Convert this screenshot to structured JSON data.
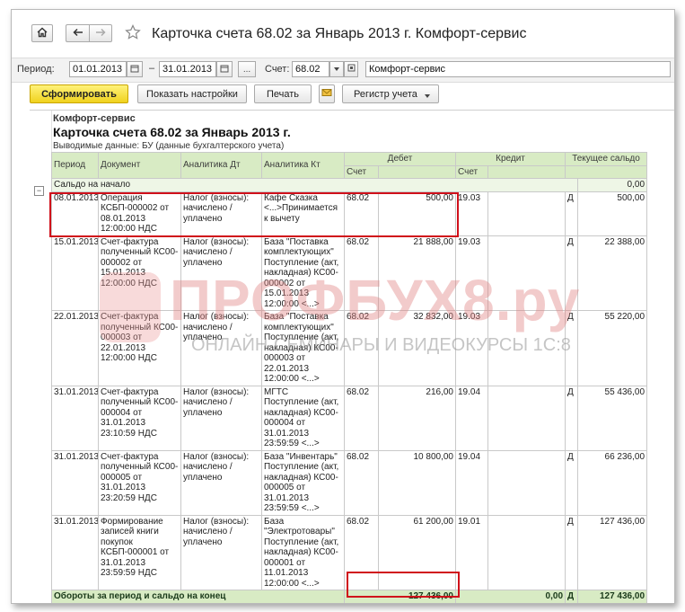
{
  "window": {
    "title": "Карточка счета 68.02 за Январь 2013 г. Комфорт-сервис",
    "home_icon": "home-icon",
    "back_icon": "arrow-left-icon",
    "forward_icon": "arrow-right-icon",
    "favorite_icon": "star-icon"
  },
  "filters": {
    "period_label": "Период:",
    "date_from": "01.01.2013",
    "dash": "–",
    "date_to": "31.01.2013",
    "more_label": "...",
    "account_label": "Счет:",
    "account_value": "68.02",
    "org_value": "Комфорт-сервис"
  },
  "toolbar": {
    "generate": "Сформировать",
    "settings": "Показать настройки",
    "print": "Печать",
    "register": "Регистр учета"
  },
  "report": {
    "org": "Комфорт-сервис",
    "title": "Карточка счета 68.02 за Январь 2013 г.",
    "subtitle": "Выводимые данные:  БУ (данные бухгалтерского учета)",
    "columns": {
      "period": "Период",
      "document": "Документ",
      "analytics_dt": "Аналитика Дт",
      "analytics_kt": "Аналитика Кт",
      "debit": "Дебет",
      "credit": "Кредит",
      "balance": "Текущее сальдо",
      "account": "Счет"
    },
    "opening": {
      "label": "Сальдо на начало",
      "value": "0,00"
    },
    "rows": [
      {
        "period": "08.01.2013",
        "document": "Операция КСБП-000002 от 08.01.2013 12:00:00 НДС",
        "dt": "Налог (взносы): начислено / уплачено",
        "kt": "Кафе Сказка <...>Принимается к вычету",
        "debit_acc": "68.02",
        "debit": "500,00",
        "credit_acc": "19.03",
        "credit": "",
        "sign": "Д",
        "balance": "500,00"
      },
      {
        "period": "15.01.2013",
        "document": "Счет-фактура полученный КС00-000002 от 15.01.2013 12:00:00 НДС",
        "dt": "Налог (взносы): начислено / уплачено",
        "kt": "База \"Поставка комплектующих\" Поступление (акт, накладная) КС00-000002 от 15.01.2013 12:00:00 <...>",
        "debit_acc": "68.02",
        "debit": "21 888,00",
        "credit_acc": "19.03",
        "credit": "",
        "sign": "Д",
        "balance": "22 388,00"
      },
      {
        "period": "22.01.2013",
        "document": "Счет-фактура полученный КС00-000003 от 22.01.2013 12:00:00 НДС",
        "dt": "Налог (взносы): начислено / уплачено",
        "kt": "База \"Поставка комплектующих\" Поступление (акт, накладная) КС00-000003 от 22.01.2013 12:00:00 <...>",
        "debit_acc": "68.02",
        "debit": "32 832,00",
        "credit_acc": "19.03",
        "credit": "",
        "sign": "Д",
        "balance": "55 220,00"
      },
      {
        "period": "31.01.2013",
        "document": "Счет-фактура полученный КС00-000004 от 31.01.2013 23:10:59 НДС",
        "dt": "Налог (взносы): начислено / уплачено",
        "kt": "МГТС Поступление (акт, накладная) КС00-000004 от 31.01.2013 23:59:59 <...>",
        "debit_acc": "68.02",
        "debit": "216,00",
        "credit_acc": "19.04",
        "credit": "",
        "sign": "Д",
        "balance": "55 436,00"
      },
      {
        "period": "31.01.2013",
        "document": "Счет-фактура полученный КС00-000005 от 31.01.2013 23:20:59 НДС",
        "dt": "Налог (взносы): начислено / уплачено",
        "kt": "База \"Инвентарь\" Поступление (акт, накладная) КС00-000005 от 31.01.2013 23:59:59 <...>",
        "debit_acc": "68.02",
        "debit": "10 800,00",
        "credit_acc": "19.04",
        "credit": "",
        "sign": "Д",
        "balance": "66 236,00"
      },
      {
        "period": "31.01.2013",
        "document": "Формирование записей книги покупок КСБП-000001 от 31.01.2013 23:59:59 НДС",
        "dt": "Налог (взносы): начислено / уплачено",
        "kt": "База \"Электротовары\" Поступление (акт, накладная) КС00-000001 от 11.01.2013 12:00:00 <...>",
        "debit_acc": "68.02",
        "debit": "61 200,00",
        "credit_acc": "19.01",
        "credit": "",
        "sign": "Д",
        "balance": "127 436,00"
      }
    ],
    "totals": {
      "label": "Обороты за период и сальдо на конец",
      "debit": "127 436,00",
      "credit": "0,00",
      "sign": "Д",
      "balance": "127 436,00"
    }
  },
  "watermark": {
    "brand": "ПРОФБУХ8.ру",
    "tagline": "ОНЛАЙН-СЕМИНАРЫ И ВИДЕОКУРСЫ 1С:8"
  },
  "colors": {
    "header_bg": "#d8ebc4",
    "highlight": "#d0101a",
    "primary_button": "#f0d21e"
  }
}
